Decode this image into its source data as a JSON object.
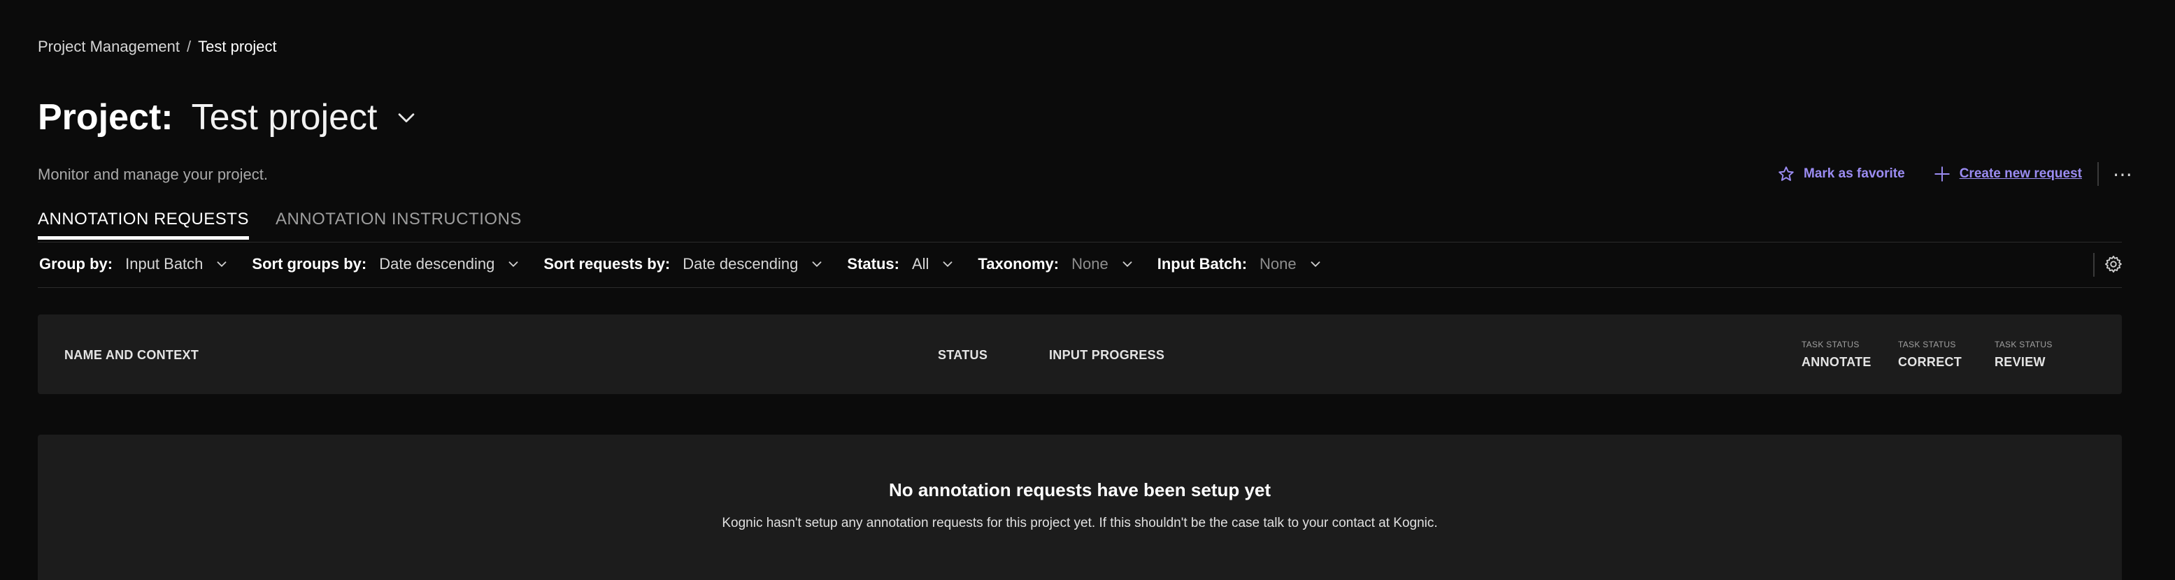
{
  "breadcrumb": {
    "parent": "Project Management",
    "separator": "/",
    "current": "Test project"
  },
  "header": {
    "title_prefix": "Project:",
    "title_name": "Test project",
    "subtitle": "Monitor and manage your project."
  },
  "actions": {
    "favorite_label": "Mark as favorite",
    "create_label": "Create new request",
    "more_label": "⋯",
    "accent_color": "#9b8cf2"
  },
  "tabs": [
    {
      "label": "ANNOTATION REQUESTS",
      "active": true
    },
    {
      "label": "ANNOTATION INSTRUCTIONS",
      "active": false
    }
  ],
  "filters": {
    "group_by": {
      "label": "Group by:",
      "value": "Input Batch"
    },
    "sort_groups_by": {
      "label": "Sort groups by:",
      "value": "Date descending"
    },
    "sort_requests_by": {
      "label": "Sort requests by:",
      "value": "Date descending"
    },
    "status": {
      "label": "Status:",
      "value": "All"
    },
    "taxonomy": {
      "label": "Taxonomy:",
      "value": "None"
    },
    "input_batch": {
      "label": "Input Batch:",
      "value": "None"
    }
  },
  "table": {
    "columns": {
      "name": "NAME AND CONTEXT",
      "status": "STATUS",
      "progress": "INPUT PROGRESS",
      "task_status_caption": "TASK STATUS",
      "annotate": "ANNOTATE",
      "correct": "CORRECT",
      "review": "REVIEW"
    }
  },
  "empty_state": {
    "title": "No annotation requests have been setup yet",
    "text": "Kognic hasn't setup any annotation requests for this project yet. If this shouldn't be the case talk to your contact at Kognic."
  }
}
